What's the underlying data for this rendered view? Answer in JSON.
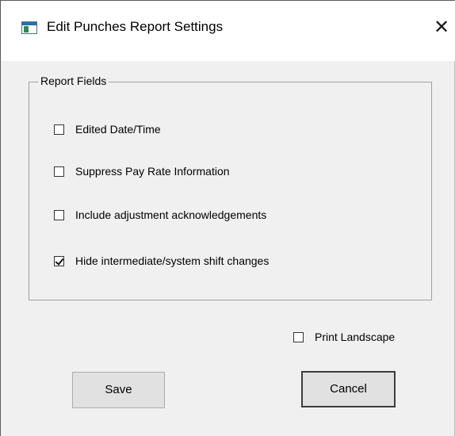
{
  "window": {
    "title": "Edit Punches Report Settings",
    "icon": "application-window-icon",
    "close_glyph": "✕"
  },
  "report_fields": {
    "legend": "Report Fields",
    "options": [
      {
        "label": "Edited Date/Time",
        "checked": false
      },
      {
        "label": "Suppress Pay Rate Information",
        "checked": false
      },
      {
        "label": "Include adjustment acknowledgements",
        "checked": false
      },
      {
        "label": "Hide intermediate/system shift changes",
        "checked": true
      }
    ]
  },
  "print_landscape": {
    "label": "Print Landscape",
    "checked": false
  },
  "buttons": {
    "save_label": "Save",
    "cancel_label": "Cancel"
  }
}
